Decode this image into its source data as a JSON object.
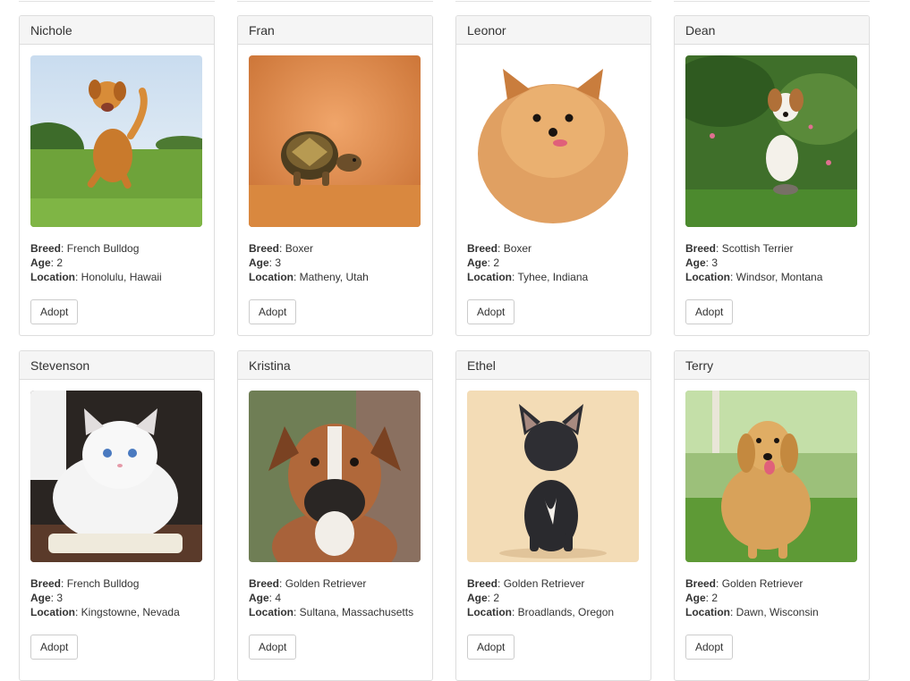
{
  "labels": {
    "breed": "Breed",
    "age": "Age",
    "location": "Location",
    "sep": ": "
  },
  "pets": [
    {
      "name": "Nichole",
      "breed": "French Bulldog",
      "age": "2",
      "location": "Honolulu, Hawaii",
      "button": "Adopt",
      "photo": "golden-retriever-running-photo"
    },
    {
      "name": "Fran",
      "breed": "Boxer",
      "age": "3",
      "location": "Matheny, Utah",
      "button": "Adopt",
      "photo": "tortoise-photo"
    },
    {
      "name": "Leonor",
      "breed": "Boxer",
      "age": "2",
      "location": "Tyhee, Indiana",
      "button": "Adopt",
      "photo": "pomeranian-photo"
    },
    {
      "name": "Dean",
      "breed": "Scottish Terrier",
      "age": "3",
      "location": "Windsor, Montana",
      "button": "Adopt",
      "photo": "puppy-in-grass-photo"
    },
    {
      "name": "Stevenson",
      "breed": "French Bulldog",
      "age": "3",
      "location": "Kingstowne, Nevada",
      "button": "Adopt",
      "photo": "white-kitten-photo"
    },
    {
      "name": "Kristina",
      "breed": "Golden Retriever",
      "age": "4",
      "location": "Sultana, Massachusetts",
      "button": "Adopt",
      "photo": "boxer-dog-photo"
    },
    {
      "name": "Ethel",
      "breed": "Golden Retriever",
      "age": "2",
      "location": "Broadlands, Oregon",
      "button": "Adopt",
      "photo": "french-bulldog-photo"
    },
    {
      "name": "Terry",
      "breed": "Golden Retriever",
      "age": "2",
      "location": "Dawn, Wisconsin",
      "button": "Adopt",
      "photo": "golden-retriever-sitting-photo"
    }
  ]
}
